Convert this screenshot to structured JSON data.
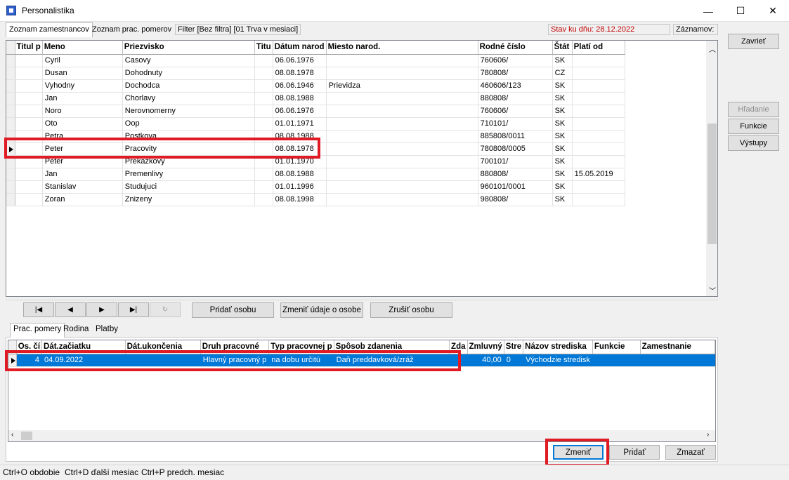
{
  "window": {
    "title": "Personalistika",
    "controls": {
      "minimize": "—",
      "maximize": "☐",
      "close": "✕"
    }
  },
  "top_tabs": [
    "Zoznam zamestnancov",
    "Zoznam prac. pomerov",
    "Filter [Bez filtra] [01 Trva v mesiaci]"
  ],
  "status_date": "Stav ku dňu: 28.12.2022",
  "zaznamov_label": "Záznamov:",
  "side_buttons": {
    "zavriet": "Zavrieť",
    "hladanie": "Hľadanie",
    "funkcie": "Funkcie",
    "vystupy": "Výstupy"
  },
  "employees": {
    "columns": [
      "Titul p",
      "Meno",
      "Priezvisko",
      "Titu",
      "Dátum narod",
      "Miesto narod.",
      "Rodné číslo",
      "Štát",
      "Platí od"
    ],
    "rows": [
      [
        "",
        "Cyril",
        "Casovy",
        "",
        "06.06.1976",
        "",
        "760606/",
        "SK",
        ""
      ],
      [
        "",
        "Dusan",
        "Dohodnuty",
        "",
        "08.08.1978",
        "",
        "780808/",
        "CZ",
        ""
      ],
      [
        "",
        "Vyhodny",
        "Dochodca",
        "",
        "06.06.1946",
        "Prievidza",
        "460606/123",
        "SK",
        ""
      ],
      [
        "",
        "Jan",
        "Chorlavy",
        "",
        "08.08.1988",
        "",
        "880808/",
        "SK",
        ""
      ],
      [
        "",
        "Noro",
        "Nerovnomerny",
        "",
        "06.06.1976",
        "",
        "760606/",
        "SK",
        ""
      ],
      [
        "",
        "Oto",
        "Oop",
        "",
        "01.01.1971",
        "",
        "710101/",
        "SK",
        ""
      ],
      [
        "",
        "Petra",
        "Postkova",
        "",
        "08.08.1988",
        "",
        "885808/0011",
        "SK",
        ""
      ],
      [
        "",
        "Peter",
        "Pracovity",
        "",
        "08.08.1978",
        "",
        "780808/0005",
        "SK",
        ""
      ],
      [
        "",
        "Peter",
        "Prekazkovy",
        "",
        "01.01.1970",
        "",
        "700101/",
        "SK",
        ""
      ],
      [
        "",
        "Jan",
        "Premenlivy",
        "",
        "08.08.1988",
        "",
        "880808/",
        "SK",
        "15.05.2019"
      ],
      [
        "",
        "Stanislav",
        "Studujuci",
        "",
        "01.01.1996",
        "",
        "960101/0001",
        "SK",
        ""
      ],
      [
        "",
        "Zoran",
        "Znizeny",
        "",
        "08.08.1998",
        "",
        "980808/",
        "SK",
        ""
      ]
    ],
    "current_row": 7
  },
  "nav": {
    "first": "|◀",
    "prev": "◀",
    "next": "▶",
    "last": "▶|",
    "refresh": "↻",
    "pridat_osobu": "Pridať osobu",
    "zmenit_udaje": "Zmeniť údaje o osobe",
    "zrusit_osobu": "Zrušiť osobu"
  },
  "bottom_tabs": [
    "Prac. pomery",
    "Rodina",
    "Platby"
  ],
  "contracts": {
    "columns": [
      "Os. čí",
      "Dát.začiatku",
      "Dát.ukončenia",
      "Druh pracovné",
      "Typ pracovnej p",
      "Spôsob zdanenia",
      "Zda",
      "Zmluvný",
      "Stre",
      "Názov strediska",
      "Funkcie",
      "Zamestnanie"
    ],
    "rows": [
      [
        "4",
        "04.09.2022",
        "",
        "Hlavný pracovný p",
        "na dobu určitú",
        "Daň preddavková/zráž",
        "",
        "40,00",
        "0",
        "Východzie stredisk",
        "",
        ""
      ]
    ]
  },
  "bottom_buttons": {
    "zmenit": "Zmeniť",
    "pridat": "Pridať",
    "zmazat": "Zmazať"
  },
  "statusbar": [
    "Ctrl+O obdobie",
    "Ctrl+D ďalší mesiac",
    "Ctrl+P predch. mesiac"
  ]
}
